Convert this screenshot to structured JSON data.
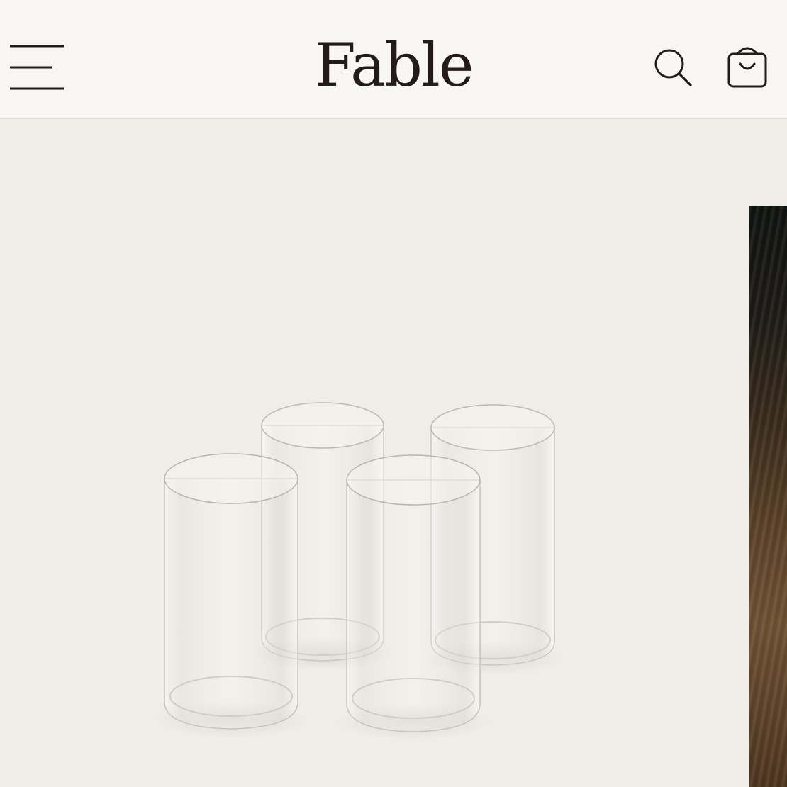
{
  "header": {
    "brand": "Fable",
    "icons": {
      "menu": "hamburger-menu-icon",
      "search": "search-icon",
      "cart": "shopping-bag-icon"
    }
  },
  "colors": {
    "header_bg": "#f7f6f2",
    "page_bg": "#f0ede6",
    "brand_text": "#231a1c",
    "icon_stroke": "#231a1c"
  },
  "carousel": {
    "current_slide": "glass-tumblers-set-of-four",
    "next_slide": "wooden-table-photo"
  }
}
